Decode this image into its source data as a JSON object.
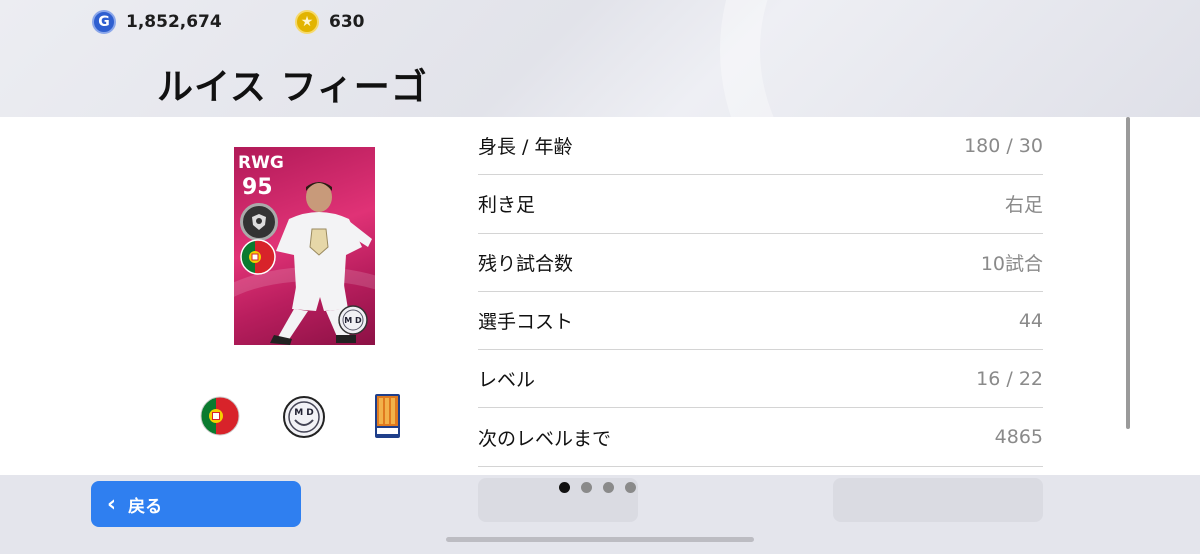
{
  "header": {
    "gp_amount": "1,852,674",
    "coin_amount": "630",
    "gp_icon_glyph": "G",
    "coin_icon_glyph": "★",
    "player_name": "ルイス フィーゴ"
  },
  "card": {
    "position": "RWG",
    "rating": "95",
    "background_color": "#d62a6c"
  },
  "icons": {
    "nationality": "portugal-flag-icon",
    "club": "club-crest-icon",
    "league": "league-espana-icon"
  },
  "info": [
    {
      "label": "身長 / 年齢",
      "value": "180 / 30"
    },
    {
      "label": "利き足",
      "value": "右足"
    },
    {
      "label": "残り試合数",
      "value": "10試合"
    },
    {
      "label": "選手コスト",
      "value": "44"
    },
    {
      "label": "レベル",
      "value": "16 / 22"
    },
    {
      "label": "次のレベルまで",
      "value": "4865"
    }
  ],
  "footer": {
    "back_label": "戻る",
    "page_count": 4,
    "active_page": 1
  },
  "colors": {
    "accent": "#2f7ff0",
    "card": "#d62a6c"
  }
}
